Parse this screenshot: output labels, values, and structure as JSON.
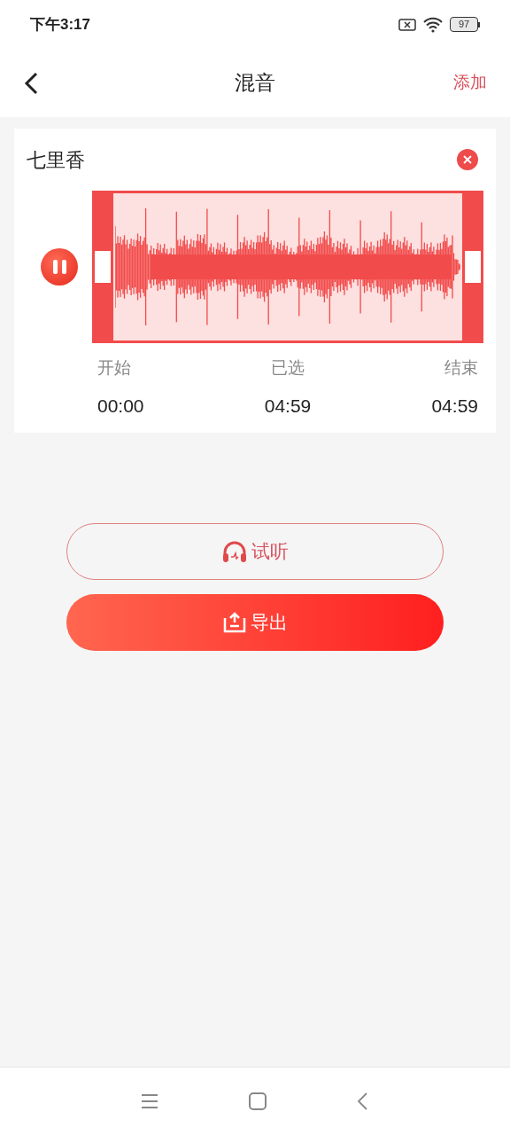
{
  "status_bar": {
    "time": "下午3:17",
    "battery": "97"
  },
  "header": {
    "title": "混音",
    "action": "添加"
  },
  "track": {
    "name": "七里香",
    "playing": true,
    "markers": [
      {
        "label": "开始",
        "value": "00:00"
      },
      {
        "label": "已选",
        "value": "04:59"
      },
      {
        "label": "结束",
        "value": "04:59"
      }
    ]
  },
  "buttons": [
    {
      "kind": "outline",
      "label": "试听"
    },
    {
      "kind": "filled",
      "label": "导出"
    }
  ]
}
